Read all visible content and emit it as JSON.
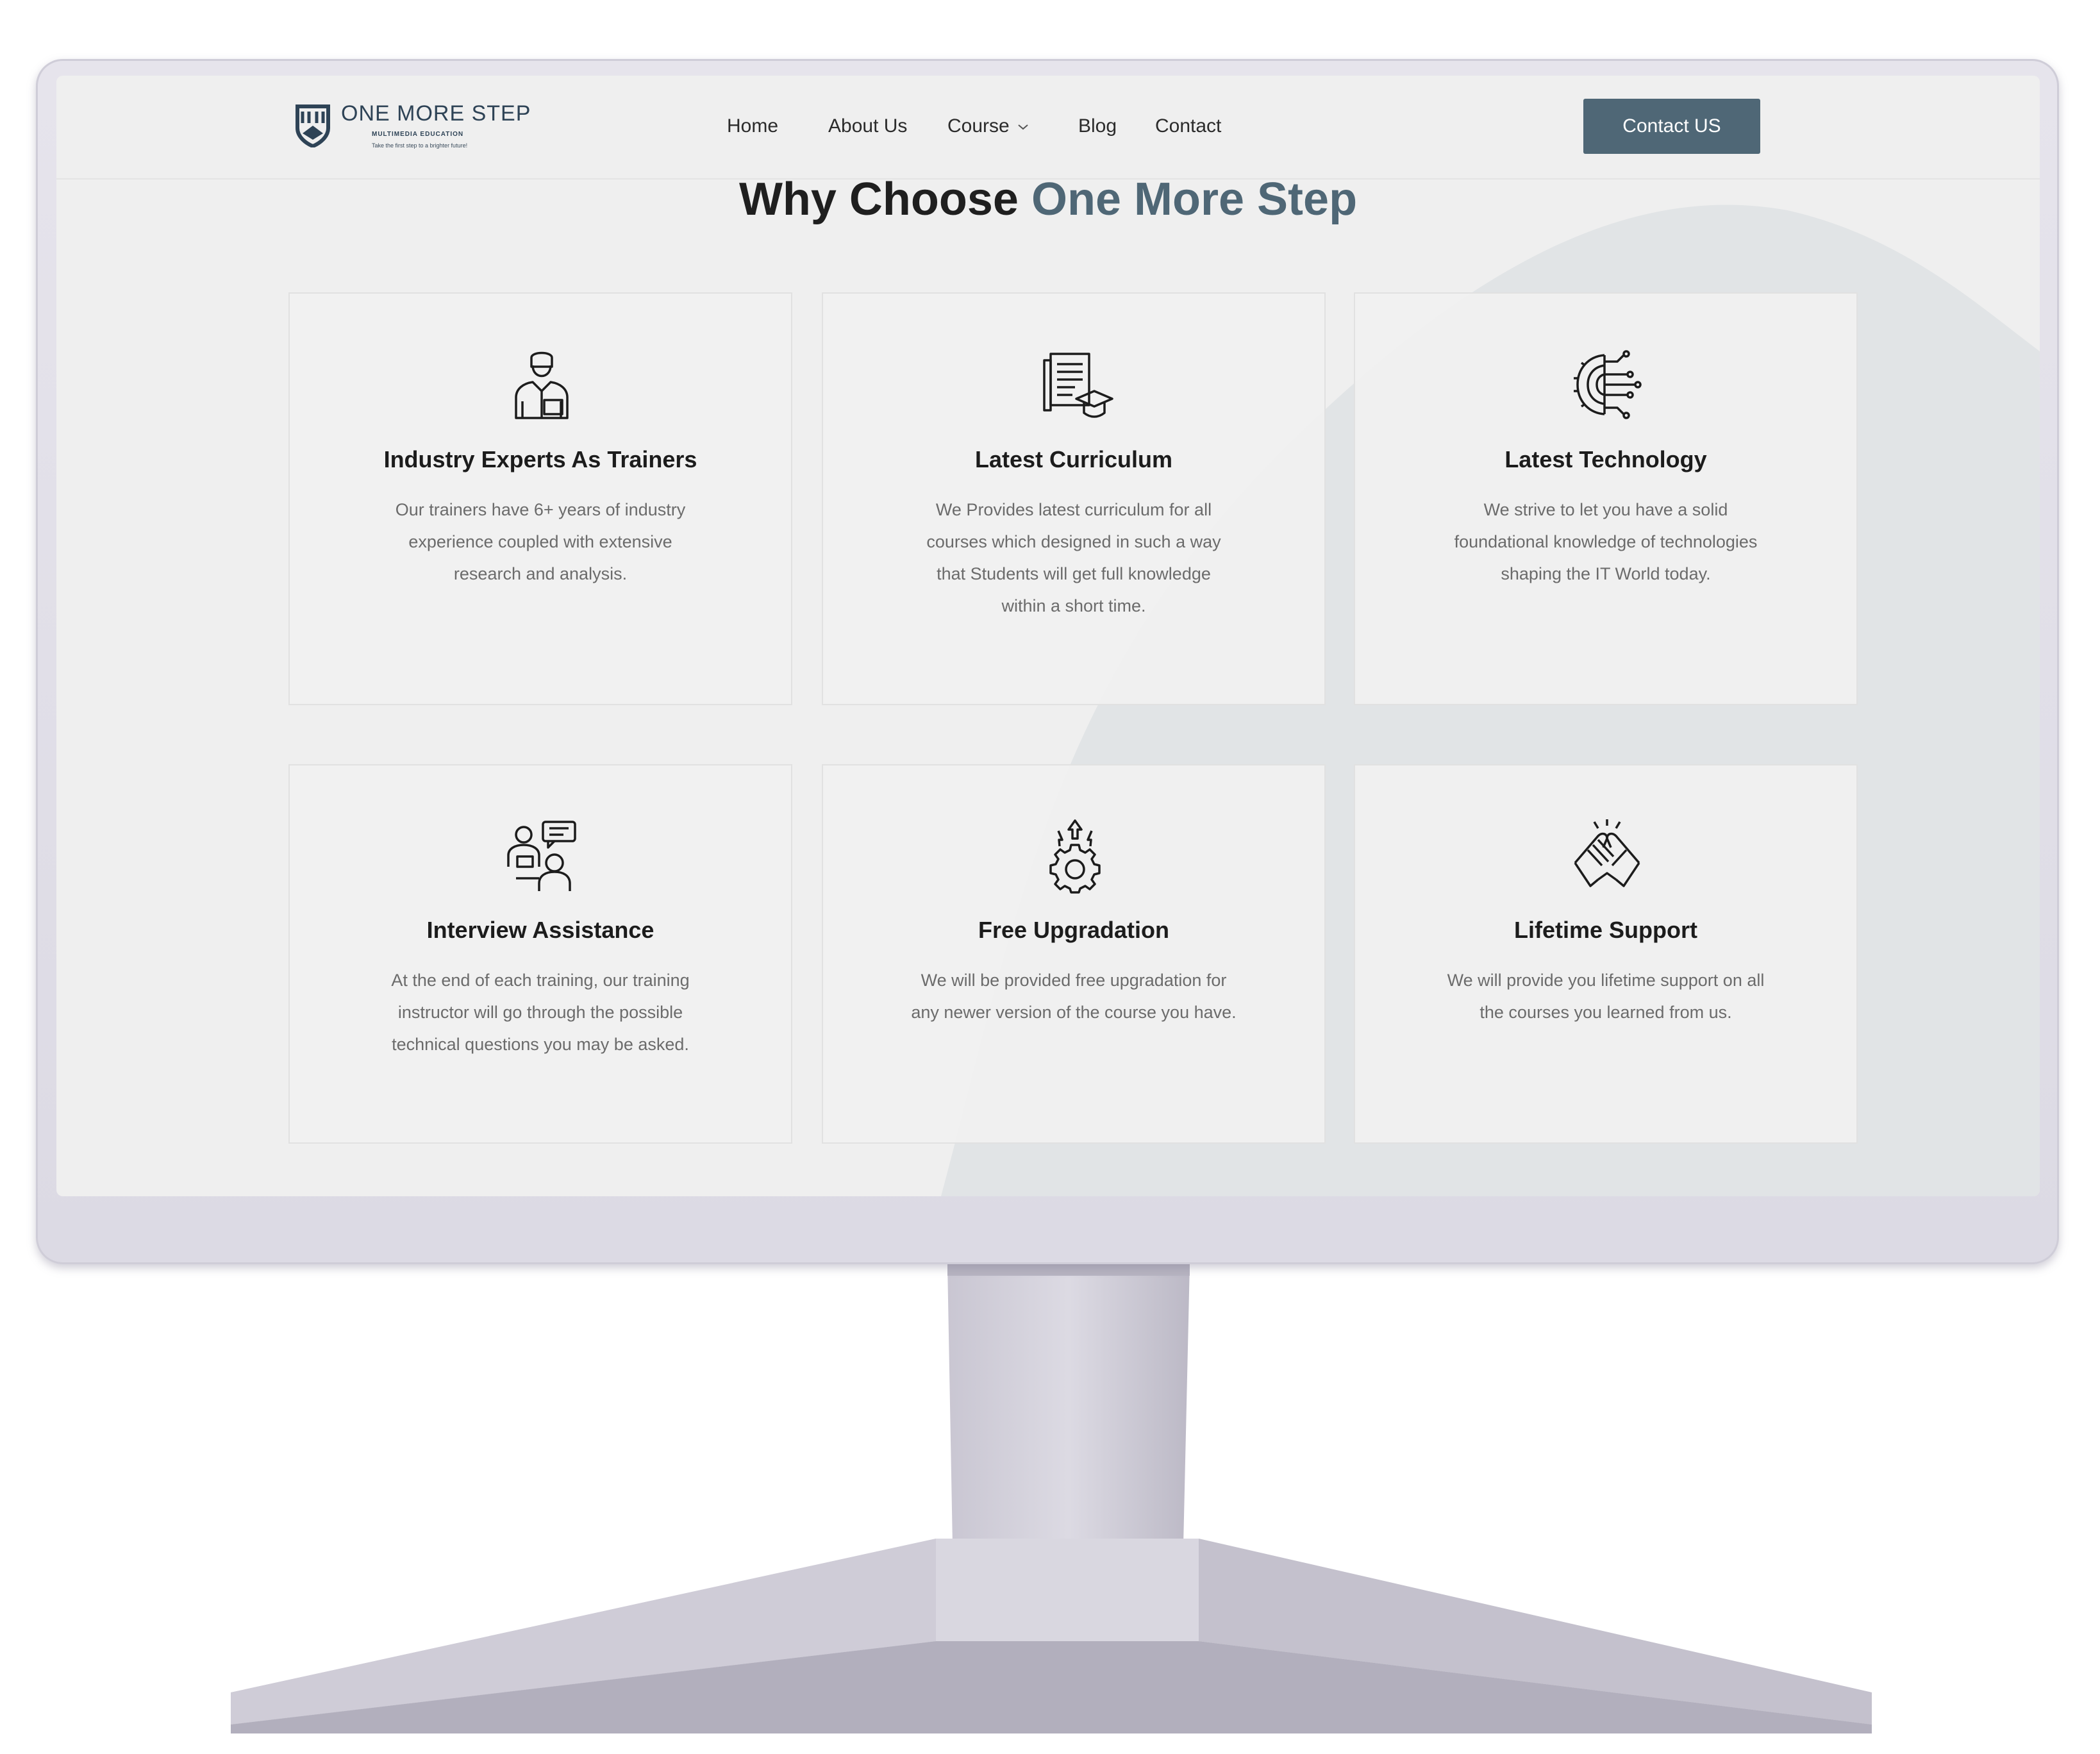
{
  "header": {
    "logo_title": "ONE MORE STEP",
    "logo_subtitle": "MULTIMEDIA EDUCATION",
    "logo_tagline": "Take the first step to a brighter future!",
    "nav": [
      "Home",
      "About Us",
      "Course",
      "Blog",
      "Contact"
    ],
    "cta_label": "Contact US"
  },
  "section": {
    "title_plain": "Why Choose",
    "title_accent": "One More Step"
  },
  "features": [
    {
      "icon": "trainer-icon",
      "title": "Industry Experts As Trainers",
      "lines": [
        "Our trainers have 6+ years of industry",
        "experience coupled with extensive",
        "research and analysis."
      ]
    },
    {
      "icon": "curriculum-icon",
      "title": "Latest Curriculum",
      "lines": [
        "We Provides latest curriculum for all",
        "courses which designed in such a way",
        "that Students will get full knowledge",
        "within a short time."
      ]
    },
    {
      "icon": "technology-icon",
      "title": "Latest Technology",
      "lines": [
        "We strive to let you have a solid",
        "foundational knowledge of technologies",
        "shaping the IT World today."
      ]
    },
    {
      "icon": "interview-icon",
      "title": "Interview Assistance",
      "lines": [
        "At the end of each training, our training",
        "instructor will go through the possible",
        "technical questions you may be asked."
      ]
    },
    {
      "icon": "upgrade-gear-icon",
      "title": "Free Upgradation",
      "lines": [
        "We will be provided free upgradation for",
        "any newer version of the course you have."
      ]
    },
    {
      "icon": "handshake-icon",
      "title": "Lifetime Support",
      "lines": [
        "We will provide you lifetime support on all",
        "the courses you learned from us."
      ]
    }
  ],
  "colors": {
    "accent": "#4f6776",
    "screen_bg": "#efefef",
    "bezel": "#e2e0ea"
  }
}
